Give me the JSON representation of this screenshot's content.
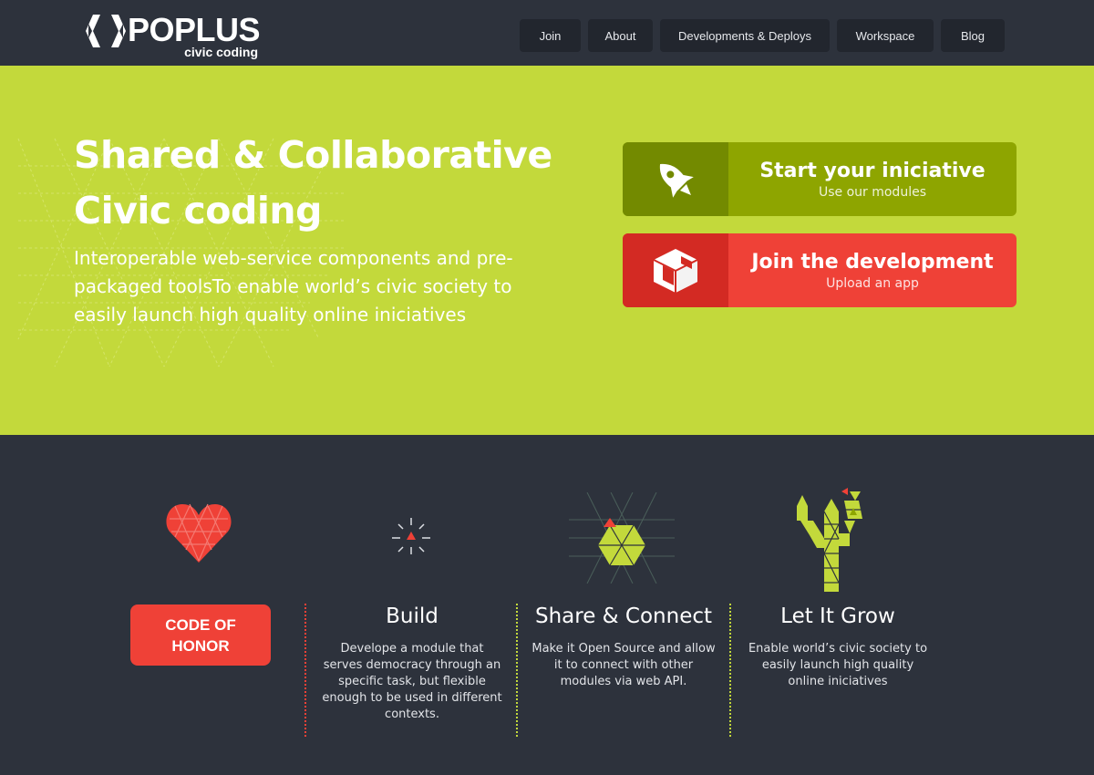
{
  "header": {
    "logo_name": "POPLUS",
    "logo_tagline": "civic coding",
    "nav": [
      {
        "label": "Join"
      },
      {
        "label": "About"
      },
      {
        "label": "Developments & Deploys"
      },
      {
        "label": "Workspace"
      },
      {
        "label": "Blog"
      }
    ]
  },
  "hero": {
    "title_line1": "Shared & Collaborative",
    "title_line2": "Civic coding",
    "subtitle": "Interoperable web-service components and pre-packaged toolsTo enable world’s civic society to easily launch high quality online iniciatives",
    "cta_start": {
      "title": "Start your iniciative",
      "subtitle": "Use our modules",
      "icon": "rocket-icon"
    },
    "cta_join": {
      "title": "Join the development",
      "subtitle": "Upload an app",
      "icon": "package-icon"
    }
  },
  "features": {
    "code_of_honor": {
      "line1": "CODE OF",
      "line2": "HONOR",
      "icon": "heart-icon"
    },
    "build": {
      "title": "Build",
      "body": "Develope a module that serves democracy through an specific task, but flexible enough to be used in different contexts.",
      "icon": "spark-icon"
    },
    "share": {
      "title": "Share & Connect",
      "body": "Make it Open Source and allow it to connect with other modules via web API.",
      "icon": "hexagon-network-icon"
    },
    "grow": {
      "title": "Let It Grow",
      "body": "Enable world’s civic society to easily launch high quality online iniciatives",
      "icon": "cactus-icon"
    }
  },
  "colors": {
    "dark_bg": "#2d323c",
    "lime": "#c3d93b",
    "olive": "#8ea500",
    "red": "#ef4137"
  }
}
